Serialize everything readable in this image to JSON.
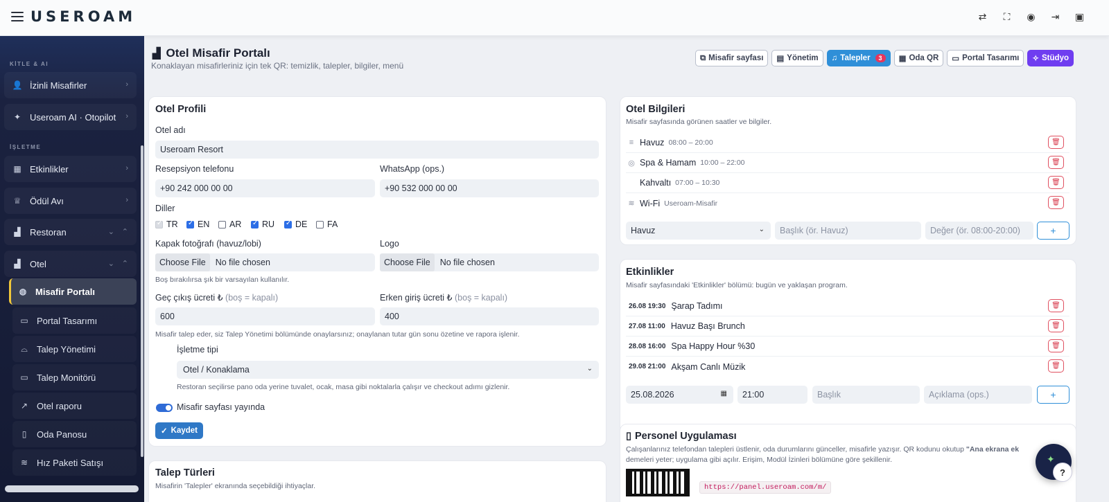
{
  "app": {
    "logo": "USEROAM"
  },
  "topbar": {
    "icons": [
      "translate-icon",
      "fullscreen-icon",
      "user-icon",
      "logout-icon",
      "window-icon"
    ]
  },
  "sidebar": {
    "section1": "KİTLE & AI",
    "section2": "İŞLETME",
    "items": [
      {
        "label": "İzinli Misafirler",
        "icon": "user-check-icon"
      },
      {
        "label": "Useroam AI · Otopilot",
        "icon": "sparkle-icon"
      },
      {
        "label": "Etkinlikler",
        "icon": "calendar-icon"
      },
      {
        "label": "Ödül Avı",
        "icon": "trophy-icon"
      },
      {
        "label": "Restoran",
        "icon": "chart-icon"
      },
      {
        "label": "Otel",
        "icon": "chart-icon"
      }
    ],
    "sub": [
      {
        "label": "Misafir Portalı",
        "icon": "globe-icon"
      },
      {
        "label": "Portal Tasarımı",
        "icon": "monitor-icon"
      },
      {
        "label": "Talep Yönetimi",
        "icon": "tray-icon"
      },
      {
        "label": "Talep Monitörü",
        "icon": "monitor-icon"
      },
      {
        "label": "Otel raporu",
        "icon": "trend-icon"
      },
      {
        "label": "Oda Panosu",
        "icon": "door-icon"
      },
      {
        "label": "Hız Paketi Satışı",
        "icon": "wifi-icon"
      }
    ]
  },
  "header": {
    "title": "Otel Misafir Portalı",
    "subtitle": "Konaklayan misafirleriniz için tek QR: temizlik, talepler, bilgiler, menü"
  },
  "tabs": [
    {
      "label": "Misafir sayfası",
      "icon": "external-link-icon"
    },
    {
      "label": "Yönetim",
      "icon": "clipboard-icon"
    },
    {
      "label": "Talepler",
      "icon": "bell-icon",
      "badge": "3"
    },
    {
      "label": "Oda QR",
      "icon": "qr-icon"
    },
    {
      "label": "Portal Tasarımı",
      "icon": "monitor-icon"
    },
    {
      "label": "Stüdyo",
      "icon": "wand-icon"
    }
  ],
  "profile": {
    "title": "Otel Profili",
    "hotel_name_label": "Otel adı",
    "hotel_name": "Useroam Resort",
    "reception_label": "Resepsiyon telefonu",
    "reception": "+90 242 000 00 00",
    "whatsapp_label": "WhatsApp (ops.)",
    "whatsapp": "+90 532 000 00 00",
    "languages_label": "Diller",
    "languages": [
      {
        "code": "TR",
        "checked": true,
        "disabled": true
      },
      {
        "code": "EN",
        "checked": true
      },
      {
        "code": "AR",
        "checked": false
      },
      {
        "code": "RU",
        "checked": true
      },
      {
        "code": "DE",
        "checked": true
      },
      {
        "code": "FA",
        "checked": false
      }
    ],
    "cover_label": "Kapak fotoğrafı (havuz/lobi)",
    "logo_label": "Logo",
    "choose_file": "Choose File",
    "no_file": "No file chosen",
    "default_hint": "Boş bırakılırsa şık bir varsayılan kullanılır.",
    "late_label": "Geç çıkış ücreti ₺",
    "late_muted": "(boş = kapalı)",
    "late_value": "600",
    "early_label": "Erken giriş ücreti ₺",
    "early_muted": "(boş = kapalı)",
    "early_value": "400",
    "fee_hint": "Misafir talep eder, siz Talep Yönetimi bölümünde onaylarsınız; onaylanan tutar gün sonu özetine ve rapora işlenir.",
    "biz_type_label": "İşletme tipi",
    "biz_type": "Otel / Konaklama",
    "biz_hint": "Restoran seçilirse pano oda yerine tuvalet, ocak, masa gibi noktalarla çalışır ve checkout adımı gizlenir.",
    "publish_label": "Misafir sayfası yayında",
    "save": "Kaydet"
  },
  "requests": {
    "title": "Talep Türleri",
    "subtitle": "Misafirin 'Talepler' ekranında seçebildiği ihtiyaçlar."
  },
  "info": {
    "title": "Otel Bilgileri",
    "subtitle": "Misafir sayfasında görünen saatler ve bilgiler.",
    "rows": [
      {
        "name": "Havuz",
        "time": "08:00 – 20:00",
        "icon": "waves-icon"
      },
      {
        "name": "Spa & Hamam",
        "time": "10:00 – 22:00",
        "icon": "spa-icon"
      },
      {
        "name": "Kahvaltı",
        "time": "07:00 – 10:30",
        "icon": ""
      },
      {
        "name": "Wi-Fi",
        "time": "Useroam-Misafir",
        "icon": "wifi-icon"
      }
    ],
    "type_select": "Havuz",
    "title_ph": "Başlık (ör. Havuz)",
    "value_ph": "Değer (ör. 08:00-20:00)"
  },
  "events": {
    "title": "Etkinlikler",
    "subtitle": "Misafir sayfasındaki 'Etkinlikler' bölümü: bugün ve yaklaşan program.",
    "rows": [
      {
        "date": "26.08 19:30",
        "name": "Şarap Tadımı"
      },
      {
        "date": "27.08 11:00",
        "name": "Havuz Başı Brunch"
      },
      {
        "date": "28.08 16:00",
        "name": "Spa Happy Hour %30"
      },
      {
        "date": "29.08 21:00",
        "name": "Akşam Canlı Müzik"
      }
    ],
    "date_value": "25.08.2026",
    "time_value": "21:00",
    "title_ph": "Başlık",
    "desc_ph": "Açıklama (ops.)"
  },
  "staff": {
    "title": "Personel Uygulaması",
    "text1a": "Çalışanlarınız telefondan talepleri üstlenir, oda durumlarını günceller, misafirle yazışır. QR kodunu okutup ",
    "text1b": "\"Ana ekrana ek",
    "text2": "demeleri yeter; uygulama gibi açılır. Erişim, Modül İzinleri bölümüne göre şekillenir.",
    "url": "https://panel.useroam.com/m/"
  },
  "colors": {
    "accent": "#2f8fd8",
    "studio": "#6f3df0",
    "danger": "#e05060",
    "sidebar": "#141a33"
  }
}
